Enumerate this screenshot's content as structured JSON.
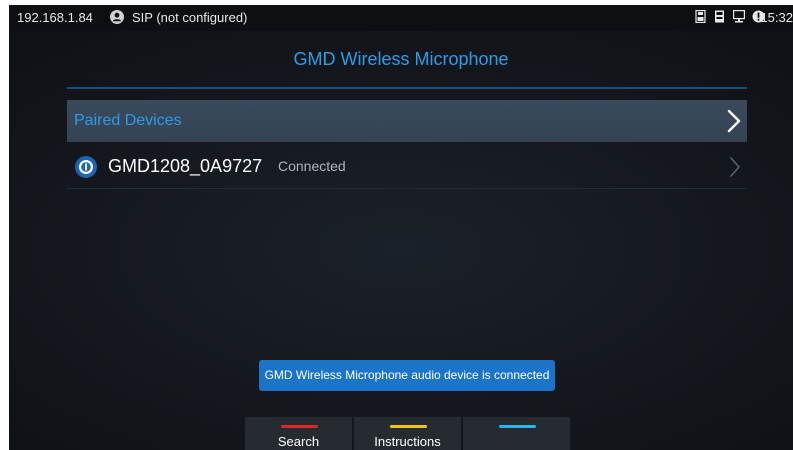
{
  "status_bar": {
    "ip": "192.168.1.84",
    "sip_status": "SIP (not configured)",
    "time": "15:32",
    "icons": [
      "sd-card-icon",
      "storage-icon",
      "network-icon",
      "alert-icon"
    ]
  },
  "page": {
    "title": "GMD Wireless Microphone"
  },
  "paired_devices": {
    "label": "Paired Devices"
  },
  "device": {
    "name": "GMD1208_0A9727",
    "status": "Connected"
  },
  "toast": {
    "message": "GMD Wireless Microphone audio device is connected"
  },
  "softkeys": [
    {
      "label": "Search",
      "color": "#e02626"
    },
    {
      "label": "Instructions",
      "color": "#f0c419"
    },
    {
      "label": "",
      "color": "#29b6e8"
    }
  ],
  "colors": {
    "accent": "#2e9be6",
    "toast_bg": "#1b74c7"
  }
}
